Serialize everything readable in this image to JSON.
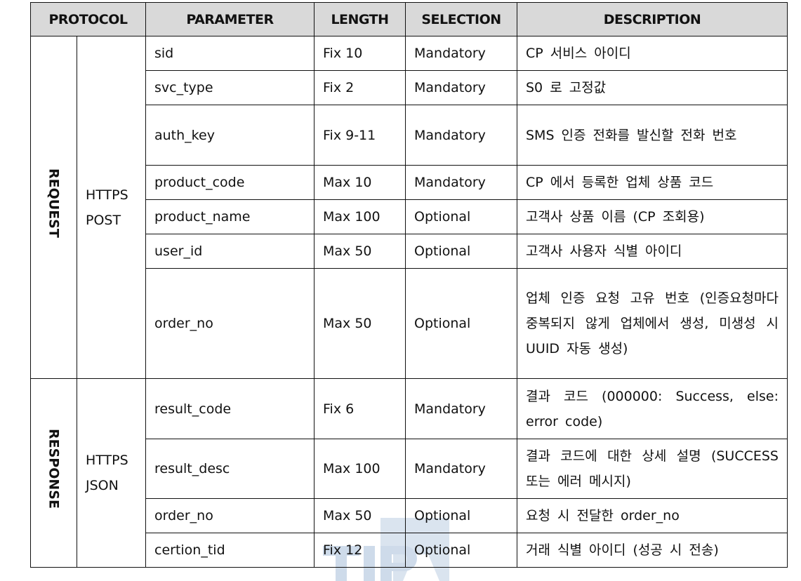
{
  "table": {
    "headers": {
      "protocol": "PROTOCOL",
      "parameter": "PARAMETER",
      "length": "LENGTH",
      "selection": "SELECTION",
      "description": "DESCRIPTION"
    },
    "request": {
      "direction": "REQUEST",
      "method_line1": "HTTPS",
      "method_line2": "POST",
      "rows": [
        {
          "parameter": "sid",
          "length": "Fix 10",
          "selection": "Mandatory",
          "description": "CP 서비스 아이디"
        },
        {
          "parameter": "svc_type",
          "length": "Fix 2",
          "selection": "Mandatory",
          "description": "S0 로 고정값"
        },
        {
          "parameter": "auth_key",
          "length": "Fix 9-11",
          "selection": "Mandatory",
          "description": "SMS 인증 전화를 발신할 전화 번호"
        },
        {
          "parameter": "product_code",
          "length": "Max 10",
          "selection": "Mandatory",
          "description": "CP 에서 등록한 업체 상품 코드"
        },
        {
          "parameter": "product_name",
          "length": "Max 100",
          "selection": "Optional",
          "description": "고객사 상품 이름 (CP 조회용)"
        },
        {
          "parameter": "user_id",
          "length": "Max 50",
          "selection": "Optional",
          "description": "고객사 사용자 식별 아이디"
        },
        {
          "parameter": "order_no",
          "length": "Max 50",
          "selection": "Optional",
          "description": "업체 인증 요청 고유 번호 (인증요청마다 중복되지 않게 업체에서 생성, 미생성 시 UUID 자동 생성)"
        }
      ]
    },
    "response": {
      "direction": "RESPONSE",
      "method_line1": "HTTPS",
      "method_line2": "JSON",
      "rows": [
        {
          "parameter": "result_code",
          "length": "Fix 6",
          "selection": "Mandatory",
          "description": "결과 코드 (000000: Success, else: error code)"
        },
        {
          "parameter": "result_desc",
          "length": "Max 100",
          "selection": "Mandatory",
          "description": "결과 코드에 대한 상세 설명 (SUCCESS 또는 에러 메시지)"
        },
        {
          "parameter": "order_no",
          "length": "Max 50",
          "selection": "Optional",
          "description": "요청 시 전달한 order_no"
        },
        {
          "parameter": "certion_tid",
          "length": "Fix 12",
          "selection": "Optional",
          "description": "거래 식별 아이디 (성공 시 전송)"
        }
      ]
    }
  },
  "watermark": {
    "text": "TIPA",
    "color": "#c5d5e6"
  },
  "colors": {
    "header_bg": "#d9d9d9",
    "border": "#111111"
  }
}
